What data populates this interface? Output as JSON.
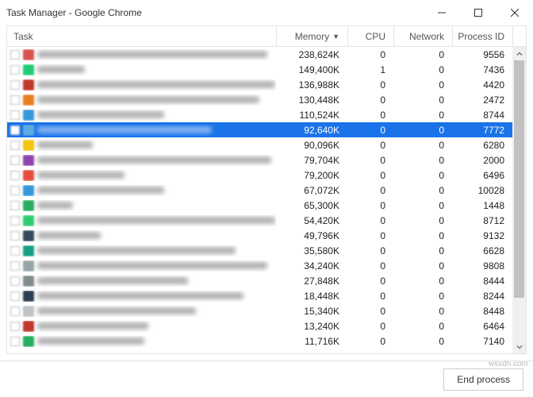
{
  "window": {
    "title": "Task Manager - Google Chrome"
  },
  "columns": {
    "task": "Task",
    "memory": "Memory",
    "sort_indicator": "▼",
    "cpu": "CPU",
    "network": "Network",
    "pid": "Process ID"
  },
  "footer": {
    "end_process": "End process"
  },
  "watermark": "wsxdn.com",
  "rows": [
    {
      "iconColor": "#d9534f",
      "textWidth": 290,
      "memory": "238,624K",
      "cpu": "0",
      "network": "0",
      "pid": "9556",
      "selected": false
    },
    {
      "iconColor": "#2c7",
      "textWidth": 60,
      "memory": "149,400K",
      "cpu": "1",
      "network": "0",
      "pid": "7436",
      "selected": false
    },
    {
      "iconColor": "#c0392b",
      "textWidth": 300,
      "memory": "136,988K",
      "cpu": "0",
      "network": "0",
      "pid": "4420",
      "selected": false
    },
    {
      "iconColor": "#e67e22",
      "textWidth": 280,
      "memory": "130,448K",
      "cpu": "0",
      "network": "0",
      "pid": "2472",
      "selected": false
    },
    {
      "iconColor": "#3498db",
      "textWidth": 160,
      "memory": "110,524K",
      "cpu": "0",
      "network": "0",
      "pid": "8744",
      "selected": false
    },
    {
      "iconColor": "#5dade2",
      "textWidth": 220,
      "memory": "92,640K",
      "cpu": "0",
      "network": "0",
      "pid": "7772",
      "selected": true
    },
    {
      "iconColor": "#f1c40f",
      "textWidth": 70,
      "memory": "90,096K",
      "cpu": "0",
      "network": "0",
      "pid": "6280",
      "selected": false
    },
    {
      "iconColor": "#8e44ad",
      "textWidth": 295,
      "memory": "79,704K",
      "cpu": "0",
      "network": "0",
      "pid": "2000",
      "selected": false
    },
    {
      "iconColor": "#e74c3c",
      "textWidth": 110,
      "memory": "79,200K",
      "cpu": "0",
      "network": "0",
      "pid": "6496",
      "selected": false
    },
    {
      "iconColor": "#3498db",
      "textWidth": 160,
      "memory": "67,072K",
      "cpu": "0",
      "network": "0",
      "pid": "10028",
      "selected": false
    },
    {
      "iconColor": "#27ae60",
      "textWidth": 45,
      "memory": "65,300K",
      "cpu": "0",
      "network": "0",
      "pid": "1448",
      "selected": false
    },
    {
      "iconColor": "#2ecc71",
      "textWidth": 300,
      "memory": "54,420K",
      "cpu": "0",
      "network": "0",
      "pid": "8712",
      "selected": false
    },
    {
      "iconColor": "#34495e",
      "textWidth": 80,
      "memory": "49,796K",
      "cpu": "0",
      "network": "0",
      "pid": "9132",
      "selected": false
    },
    {
      "iconColor": "#16a085",
      "textWidth": 250,
      "memory": "35,580K",
      "cpu": "0",
      "network": "0",
      "pid": "6628",
      "selected": false
    },
    {
      "iconColor": "#95a5a6",
      "textWidth": 290,
      "memory": "34,240K",
      "cpu": "0",
      "network": "0",
      "pid": "9808",
      "selected": false
    },
    {
      "iconColor": "#7f8c8d",
      "textWidth": 190,
      "memory": "27,848K",
      "cpu": "0",
      "network": "0",
      "pid": "8444",
      "selected": false
    },
    {
      "iconColor": "#2c3e50",
      "textWidth": 260,
      "memory": "18,448K",
      "cpu": "0",
      "network": "0",
      "pid": "8244",
      "selected": false
    },
    {
      "iconColor": "#bdc3c7",
      "textWidth": 200,
      "memory": "15,340K",
      "cpu": "0",
      "network": "0",
      "pid": "8448",
      "selected": false
    },
    {
      "iconColor": "#c0392b",
      "textWidth": 140,
      "memory": "13,240K",
      "cpu": "0",
      "network": "0",
      "pid": "6464",
      "selected": false
    },
    {
      "iconColor": "#27ae60",
      "textWidth": 135,
      "memory": "11,716K",
      "cpu": "0",
      "network": "0",
      "pid": "7140",
      "selected": false
    }
  ]
}
